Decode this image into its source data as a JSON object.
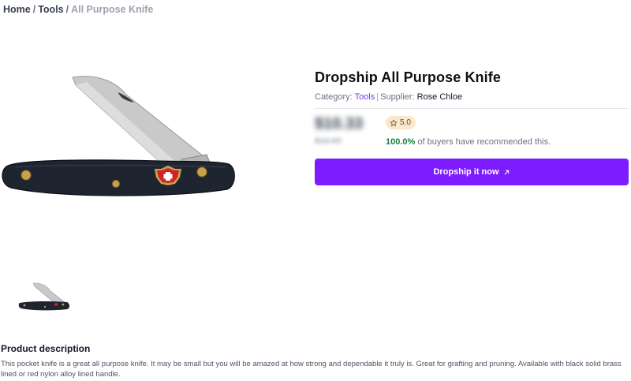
{
  "breadcrumb": {
    "home": "Home",
    "separator": "/",
    "category": "Tools",
    "current": "All Purpose Knife"
  },
  "product": {
    "title": "Dropship All Purpose Knife",
    "category_label": "Category:",
    "category_value": "Tools",
    "meta_divider": "|",
    "supplier_label": "Supplier:",
    "supplier_value": "Rose Chloe",
    "price": "$10.33",
    "old_price": "$16.83",
    "price_blurred": true,
    "rating": "5.0",
    "recommend_pct": "100.0%",
    "recommend_text": "of buyers have recommended this.",
    "cta_label": "Dropship it now",
    "cta_icon": "arrow-up-right-icon",
    "rating_icon": "star-outline-icon"
  },
  "images": {
    "main": "pocket-knife-image",
    "thumbnail": "pocket-knife-thumbnail"
  },
  "description": {
    "heading": "Product description",
    "text": "This pocket knife is a great all purpose knife. It may be small but you will be amazed at how strong and dependable it truly is. Great for grafting and pruning. Available with black solid brass lined or red nylon alloy lined handle."
  },
  "colors": {
    "accent": "#7c1cff",
    "link": "#7c3aed",
    "rating_bg": "#fde7c8",
    "recommend_green": "#15803d"
  }
}
